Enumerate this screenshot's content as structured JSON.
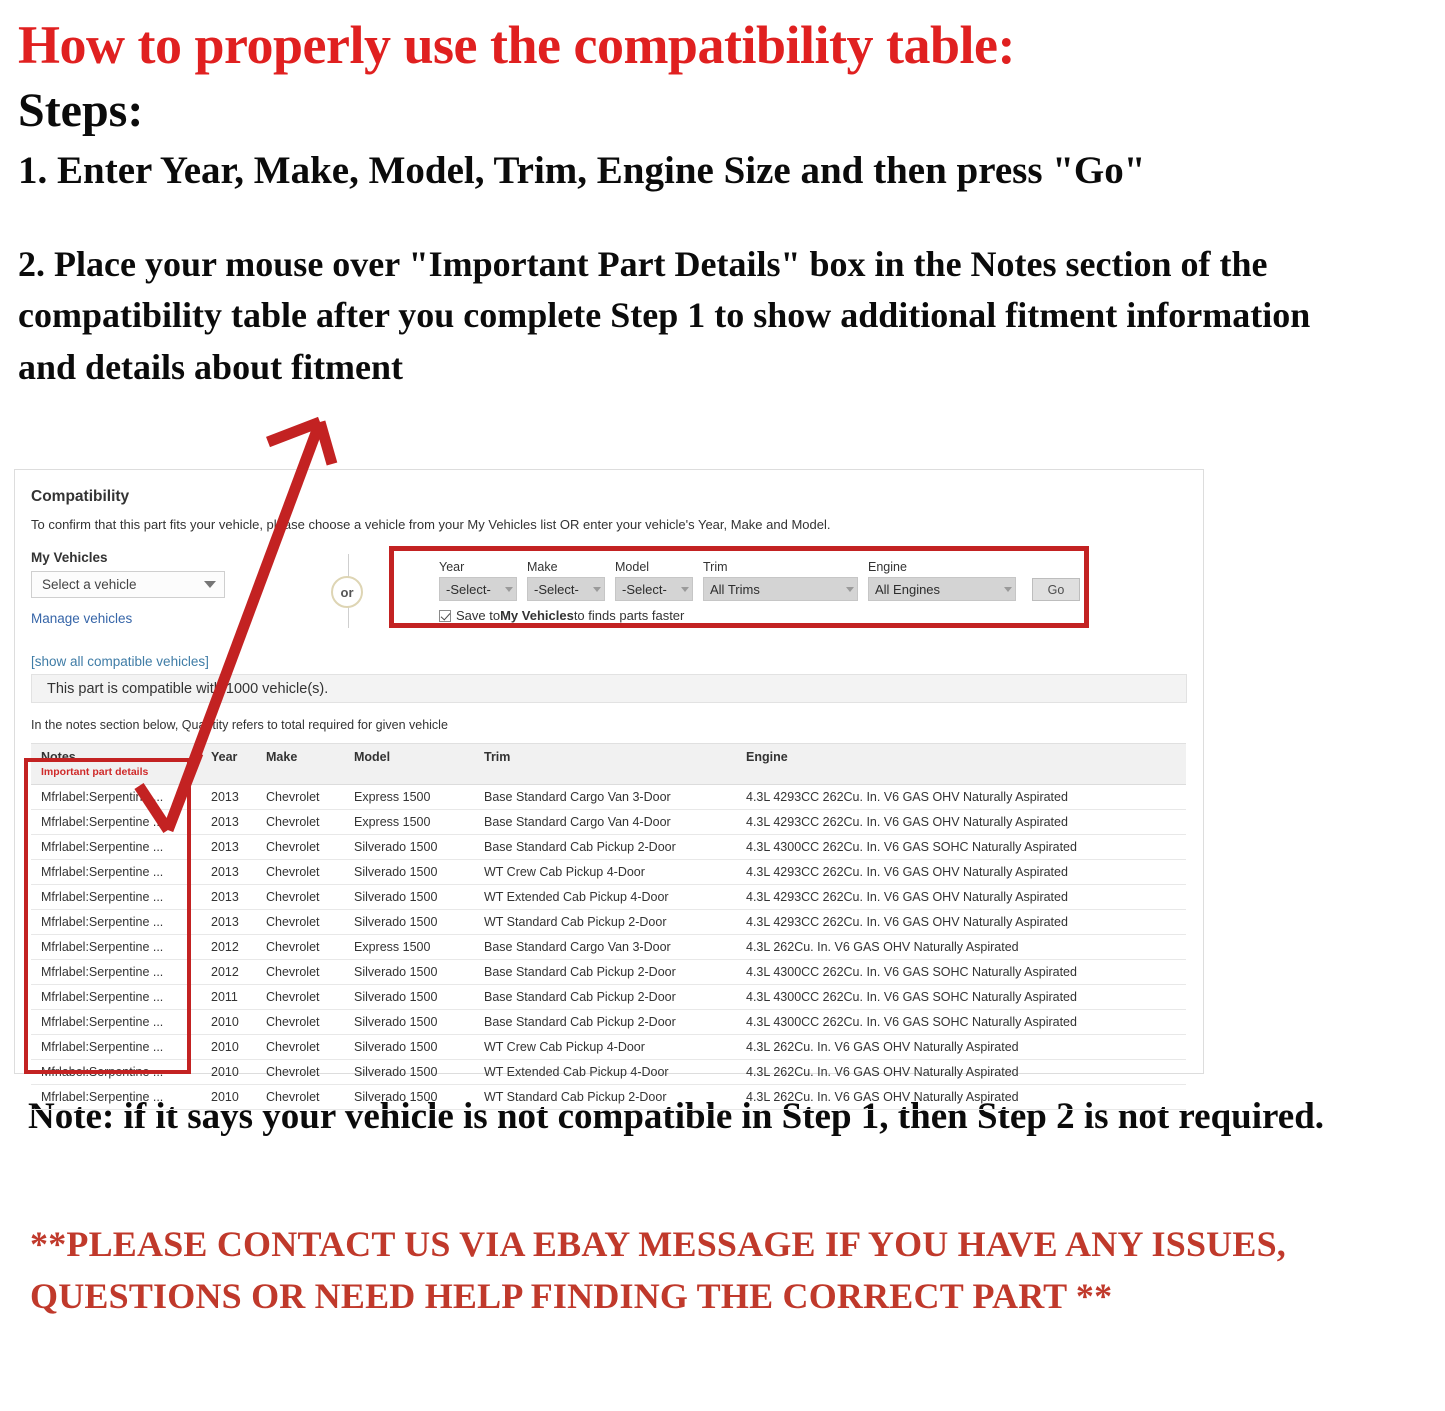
{
  "header": {
    "title": "How to properly use the compatibility table:",
    "steps_label": "Steps:",
    "step1": "1. Enter Year, Make, Model, Trim, Engine Size and then press \"Go\"",
    "step2": "2. Place your mouse over \"Important Part Details\" box in the Notes section of the compatibility table after you complete Step 1 to show additional fitment information and details about fitment"
  },
  "colors": {
    "headline_red": "#e02020",
    "annotation_red": "#c32222",
    "link_blue": "#3665a8",
    "notes_red": "#cf2a2a",
    "footer_red": "#c0392b"
  },
  "compat": {
    "title": "Compatibility",
    "subtitle": "To confirm that this part fits your vehicle, please choose a vehicle from your My Vehicles list OR enter your vehicle's Year, Make and Model.",
    "my_vehicles_label": "My Vehicles",
    "my_vehicles_value": "Select a vehicle",
    "manage_vehicles_link": "Manage vehicles",
    "show_all_link": "[show all compatible vehicles]",
    "or_label": "or",
    "banner": "This part is compatible with 1000 vehicle(s).",
    "notes_hint": "In the notes section below, Quantity refers to total required for given vehicle",
    "form": {
      "year_label": "Year",
      "year_value": "-Select-",
      "make_label": "Make",
      "make_value": "-Select-",
      "model_label": "Model",
      "model_value": "-Select-",
      "trim_label": "Trim",
      "trim_value": "All Trims",
      "engine_label": "Engine",
      "engine_value": "All Engines",
      "go_label": "Go",
      "save_prefix": "Save to ",
      "save_bold": "My Vehicles",
      "save_suffix": " to finds parts faster"
    }
  },
  "table": {
    "headers": {
      "notes": "Notes",
      "notes_sub": "Important part details",
      "year": "Year",
      "make": "Make",
      "model": "Model",
      "trim": "Trim",
      "engine": "Engine"
    },
    "rows": [
      {
        "notes": "Mfrlabel:Serpentine ...",
        "year": "2013",
        "make": "Chevrolet",
        "model": "Express 1500",
        "trim": "Base Standard Cargo Van 3-Door",
        "engine": "4.3L 4293CC 262Cu. In. V6 GAS OHV Naturally Aspirated"
      },
      {
        "notes": "Mfrlabel:Serpentine ...",
        "year": "2013",
        "make": "Chevrolet",
        "model": "Express 1500",
        "trim": "Base Standard Cargo Van 4-Door",
        "engine": "4.3L 4293CC 262Cu. In. V6 GAS OHV Naturally Aspirated"
      },
      {
        "notes": "Mfrlabel:Serpentine ...",
        "year": "2013",
        "make": "Chevrolet",
        "model": "Silverado 1500",
        "trim": "Base Standard Cab Pickup 2-Door",
        "engine": "4.3L 4300CC 262Cu. In. V6 GAS SOHC Naturally Aspirated"
      },
      {
        "notes": "Mfrlabel:Serpentine ...",
        "year": "2013",
        "make": "Chevrolet",
        "model": "Silverado 1500",
        "trim": "WT Crew Cab Pickup 4-Door",
        "engine": "4.3L 4293CC 262Cu. In. V6 GAS OHV Naturally Aspirated"
      },
      {
        "notes": "Mfrlabel:Serpentine ...",
        "year": "2013",
        "make": "Chevrolet",
        "model": "Silverado 1500",
        "trim": "WT Extended Cab Pickup 4-Door",
        "engine": "4.3L 4293CC 262Cu. In. V6 GAS OHV Naturally Aspirated"
      },
      {
        "notes": "Mfrlabel:Serpentine ...",
        "year": "2013",
        "make": "Chevrolet",
        "model": "Silverado 1500",
        "trim": "WT Standard Cab Pickup 2-Door",
        "engine": "4.3L 4293CC 262Cu. In. V6 GAS OHV Naturally Aspirated"
      },
      {
        "notes": "Mfrlabel:Serpentine ...",
        "year": "2012",
        "make": "Chevrolet",
        "model": "Express 1500",
        "trim": "Base Standard Cargo Van 3-Door",
        "engine": "4.3L 262Cu. In. V6 GAS OHV Naturally Aspirated"
      },
      {
        "notes": "Mfrlabel:Serpentine ...",
        "year": "2012",
        "make": "Chevrolet",
        "model": "Silverado 1500",
        "trim": "Base Standard Cab Pickup 2-Door",
        "engine": "4.3L 4300CC 262Cu. In. V6 GAS SOHC Naturally Aspirated"
      },
      {
        "notes": "Mfrlabel:Serpentine ...",
        "year": "2011",
        "make": "Chevrolet",
        "model": "Silverado 1500",
        "trim": "Base Standard Cab Pickup 2-Door",
        "engine": "4.3L 4300CC 262Cu. In. V6 GAS SOHC Naturally Aspirated"
      },
      {
        "notes": "Mfrlabel:Serpentine ...",
        "year": "2010",
        "make": "Chevrolet",
        "model": "Silverado 1500",
        "trim": "Base Standard Cab Pickup 2-Door",
        "engine": "4.3L 4300CC 262Cu. In. V6 GAS SOHC Naturally Aspirated"
      },
      {
        "notes": "Mfrlabel:Serpentine ...",
        "year": "2010",
        "make": "Chevrolet",
        "model": "Silverado 1500",
        "trim": "WT Crew Cab Pickup 4-Door",
        "engine": "4.3L 262Cu. In. V6 GAS OHV Naturally Aspirated"
      },
      {
        "notes": "Mfrlabel:Serpentine ...",
        "year": "2010",
        "make": "Chevrolet",
        "model": "Silverado 1500",
        "trim": "WT Extended Cab Pickup 4-Door",
        "engine": "4.3L 262Cu. In. V6 GAS OHV Naturally Aspirated"
      },
      {
        "notes": "Mfrlabel:Serpentine ...",
        "year": "2010",
        "make": "Chevrolet",
        "model": "Silverado 1500",
        "trim": "WT Standard Cab Pickup 2-Door",
        "engine": "4.3L 262Cu. In. V6 GAS OHV Naturally Aspirated"
      }
    ]
  },
  "footer": {
    "note": "Note: if it says your vehicle is not compatible in Step 1, then Step 2 is not required.",
    "contact": "**PLEASE CONTACT US VIA EBAY MESSAGE IF YOU HAVE ANY ISSUES, QUESTIONS OR NEED HELP FINDING THE CORRECT PART **"
  }
}
